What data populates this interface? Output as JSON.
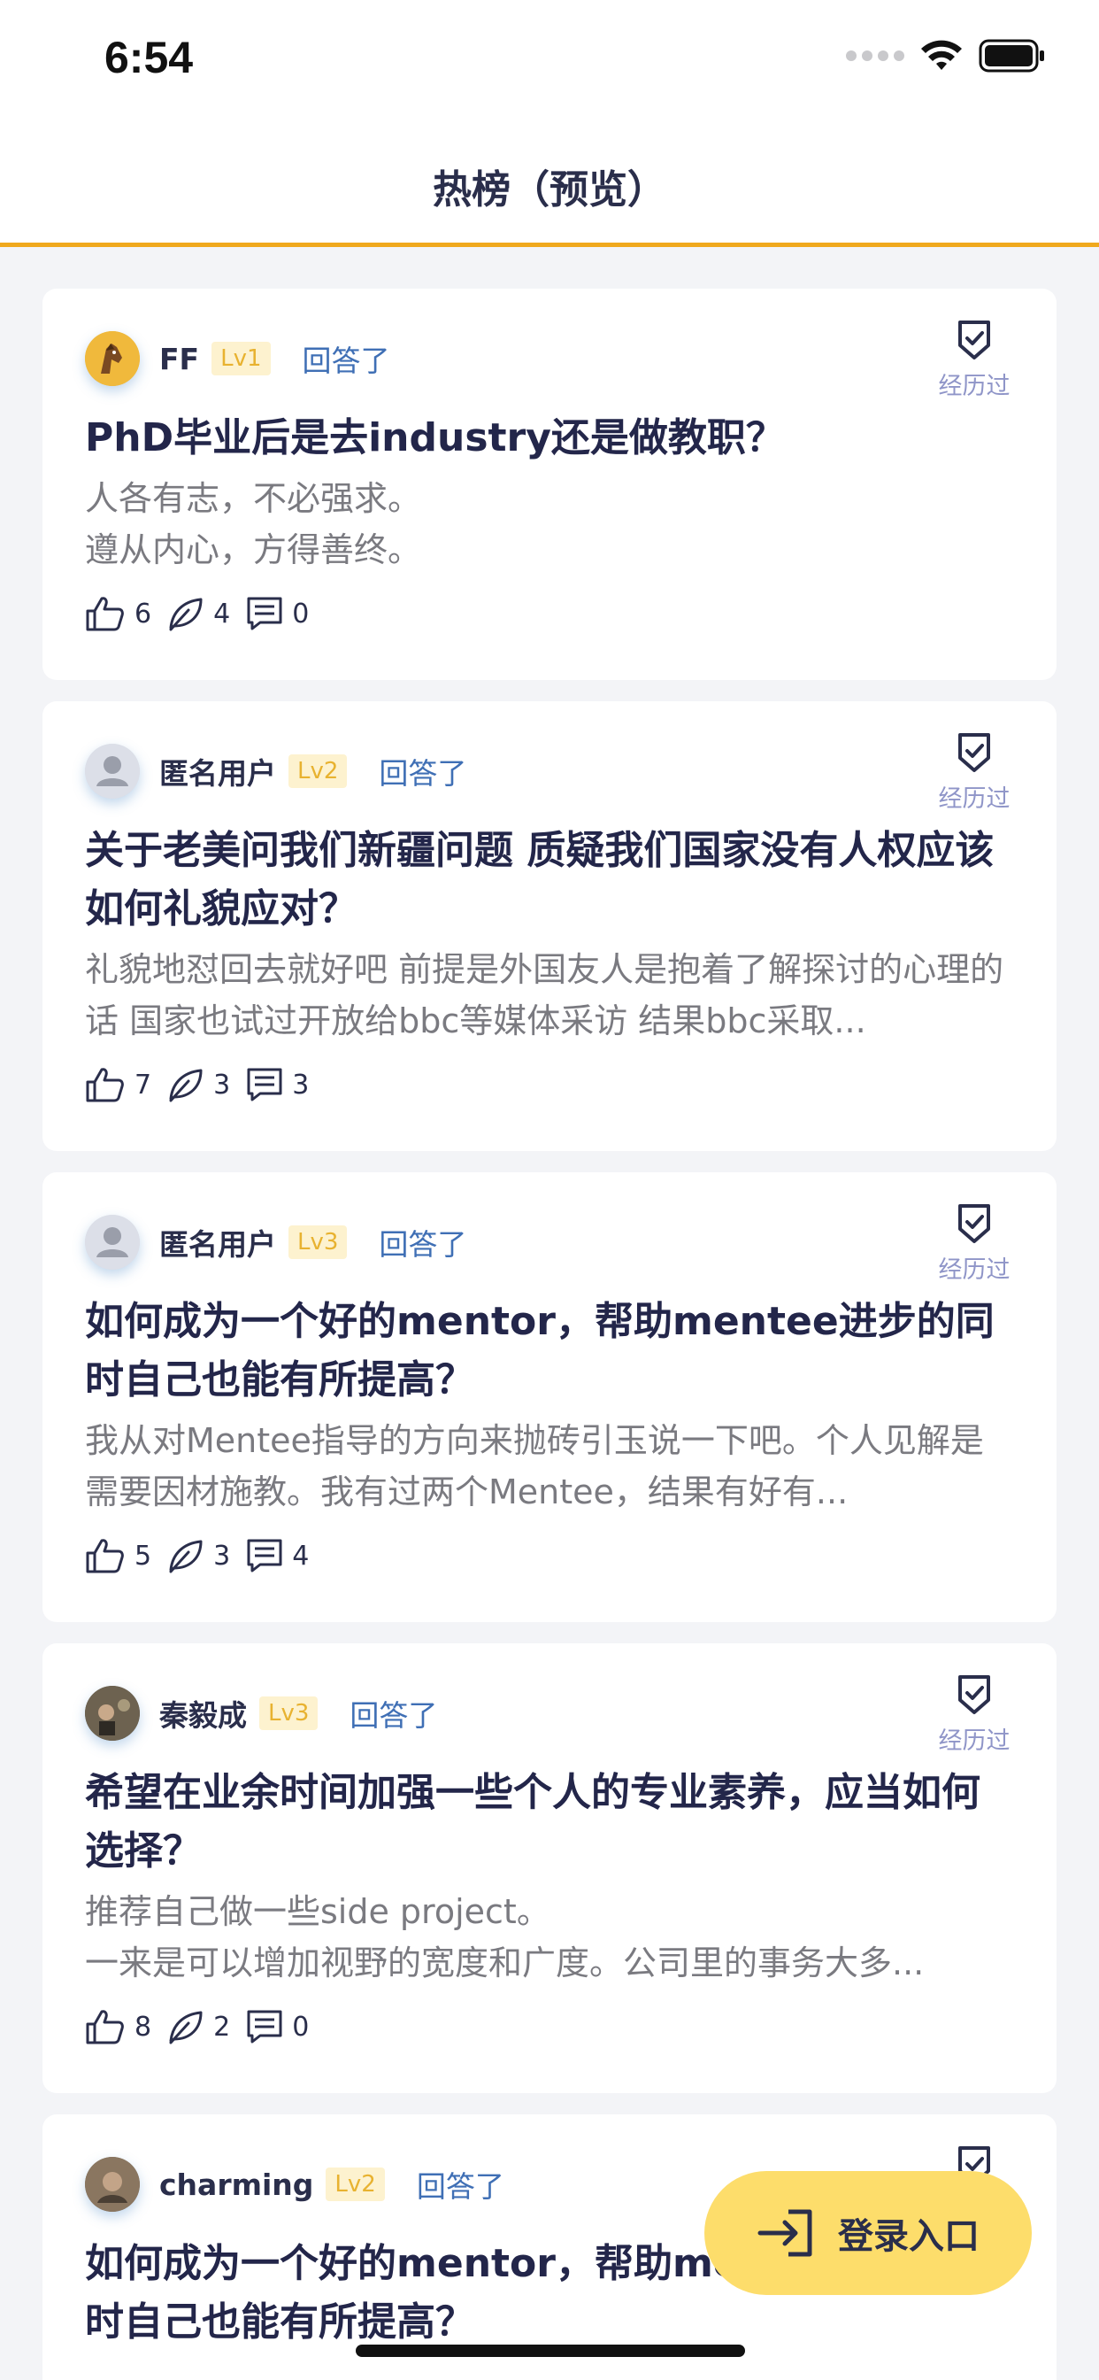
{
  "status_bar": {
    "time": "6:54"
  },
  "nav": {
    "title": "热榜（预览）"
  },
  "accent_color": "#f0a91d",
  "feed": [
    {
      "author": "FF",
      "level": "Lv1",
      "action": "回答了",
      "avatar": "horse-avatar",
      "experienced_label": "经历过",
      "title": "PhD毕业后是去industry还是做教职？",
      "excerpt_lines": [
        "人各有志，不必强求。",
        "遵从内心，方得善终。"
      ],
      "likes": "6",
      "agrees": "4",
      "comments": "0"
    },
    {
      "author": "匿名用户",
      "level": "Lv2",
      "action": "回答了",
      "avatar": "default-avatar",
      "experienced_label": "经历过",
      "title": "关于老美问我们新疆问题 质疑我们国家没有人权应该如何礼貌应对？",
      "excerpt": "礼貌地怼回去就好吧 前提是外国友人是抱着了解探讨的心理的话 国家也试过开放给bbc等媒体采访 结果bbc采取...",
      "likes": "7",
      "agrees": "3",
      "comments": "3"
    },
    {
      "author": "匿名用户",
      "level": "Lv3",
      "action": "回答了",
      "avatar": "default-avatar",
      "experienced_label": "经历过",
      "title": "如何成为一个好的mentor，帮助mentee进步的同时自己也能有所提高？",
      "excerpt": "我从对Mentee指导的方向来抛砖引玉说一下吧。个人见解是需要因材施教。我有过两个Mentee，结果有好有...",
      "likes": "5",
      "agrees": "3",
      "comments": "4"
    },
    {
      "author": "秦毅成",
      "level": "Lv3",
      "action": "回答了",
      "avatar": "photo-avatar",
      "experienced_label": "经历过",
      "title": "希望在业余时间加强一些个人的专业素养，应当如何选择？",
      "excerpt_lines": [
        "推荐自己做一些side project。",
        "一来是可以增加视野的宽度和广度。公司里的事务大多..."
      ],
      "likes": "8",
      "agrees": "2",
      "comments": "0"
    },
    {
      "author": "charming",
      "level": "Lv2",
      "action": "回答了",
      "avatar": "photo-avatar",
      "title": "如何成为一个好的mentor，帮助mentee进步的同时自己也能有所提高？"
    }
  ],
  "login_button": {
    "label": "登录入口"
  }
}
